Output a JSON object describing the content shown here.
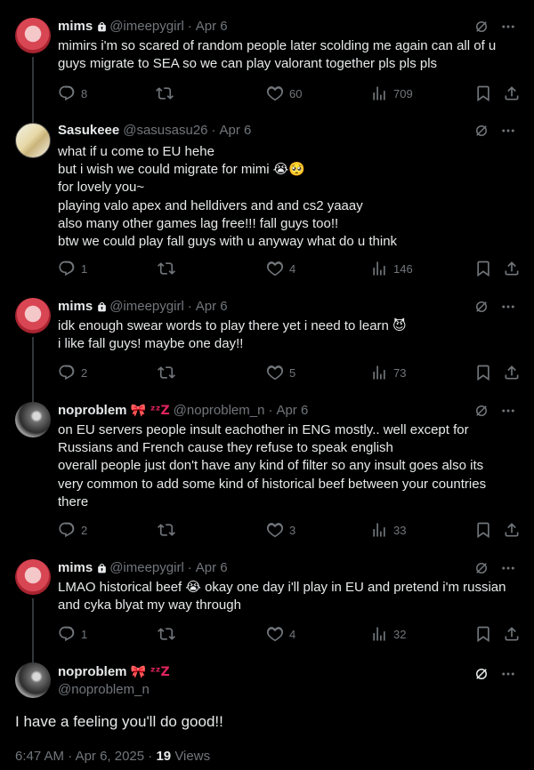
{
  "replies": [
    {
      "name": "mims",
      "locked": true,
      "handle": "@imeepygirl",
      "sep": "·",
      "date": "Apr 6",
      "lines": [
        "mimirs i'm so scared of random people later scolding me again can all of u",
        "guys migrate to SEA so we can play valorant together pls pls pls"
      ],
      "stats": {
        "replies": "8",
        "reposts": "",
        "likes": "60",
        "views": "709"
      }
    },
    {
      "name": "Sasukeee",
      "locked": false,
      "handle": "@sasusasu26",
      "sep": "·",
      "date": "Apr 6",
      "lines": [
        "what if u come to EU hehe",
        "but i wish we could migrate for mimi 😭🥺",
        "for lovely you~",
        "playing valo apex and helldivers and and cs2 yaaay",
        "also many other games lag free!!! fall guys too!!",
        "btw we could play fall guys with u anyway what do u think"
      ],
      "stats": {
        "replies": "1",
        "reposts": "",
        "likes": "4",
        "views": "146"
      }
    },
    {
      "name": "mims",
      "locked": true,
      "handle": "@imeepygirl",
      "sep": "·",
      "date": "Apr 6",
      "lines": [
        "idk enough swear words to play there yet i need to learn 😈",
        "i like fall guys! maybe one day!!"
      ],
      "stats": {
        "replies": "2",
        "reposts": "",
        "likes": "5",
        "views": "73"
      }
    },
    {
      "name": "noproblem",
      "name_suffix": "🎀 ᶻᶻZ",
      "locked": false,
      "handle": "@noproblem_n",
      "sep": "·",
      "date": "Apr 6",
      "lines": [
        "on EU servers people insult eachother in ENG mostly.. well except for",
        "Russians and French cause they refuse to speak english",
        "overall people just don't have any kind of filter so any insult goes also its",
        "very common to add some kind of historical beef between your countries",
        "there"
      ],
      "stats": {
        "replies": "2",
        "reposts": "",
        "likes": "3",
        "views": "33"
      }
    },
    {
      "name": "mims",
      "locked": true,
      "handle": "@imeepygirl",
      "sep": "·",
      "date": "Apr 6",
      "lines": [
        "LMAO historical beef 😭 okay one day i'll play in EU and pretend i'm russian",
        "and cyka blyat my way through"
      ],
      "stats": {
        "replies": "1",
        "reposts": "",
        "likes": "4",
        "views": "32"
      }
    }
  ],
  "main": {
    "name": "noproblem",
    "name_suffix": "🎀 ᶻᶻZ",
    "handle": "@noproblem_n",
    "text": "I have a feeling you'll do good!!",
    "time": "6:47 AM",
    "sep": "·",
    "date": "Apr 6, 2025",
    "views_sep": "·",
    "views_count": "19",
    "views_label": "Views"
  },
  "colors": {
    "background": "#000000",
    "text": "#e7e9ea",
    "muted": "#71767b",
    "thread_line": "#333639"
  },
  "icons": [
    "lock-icon",
    "grok-icon",
    "more-icon",
    "reply-icon",
    "repost-icon",
    "like-icon",
    "views-icon",
    "bookmark-icon",
    "share-icon"
  ]
}
